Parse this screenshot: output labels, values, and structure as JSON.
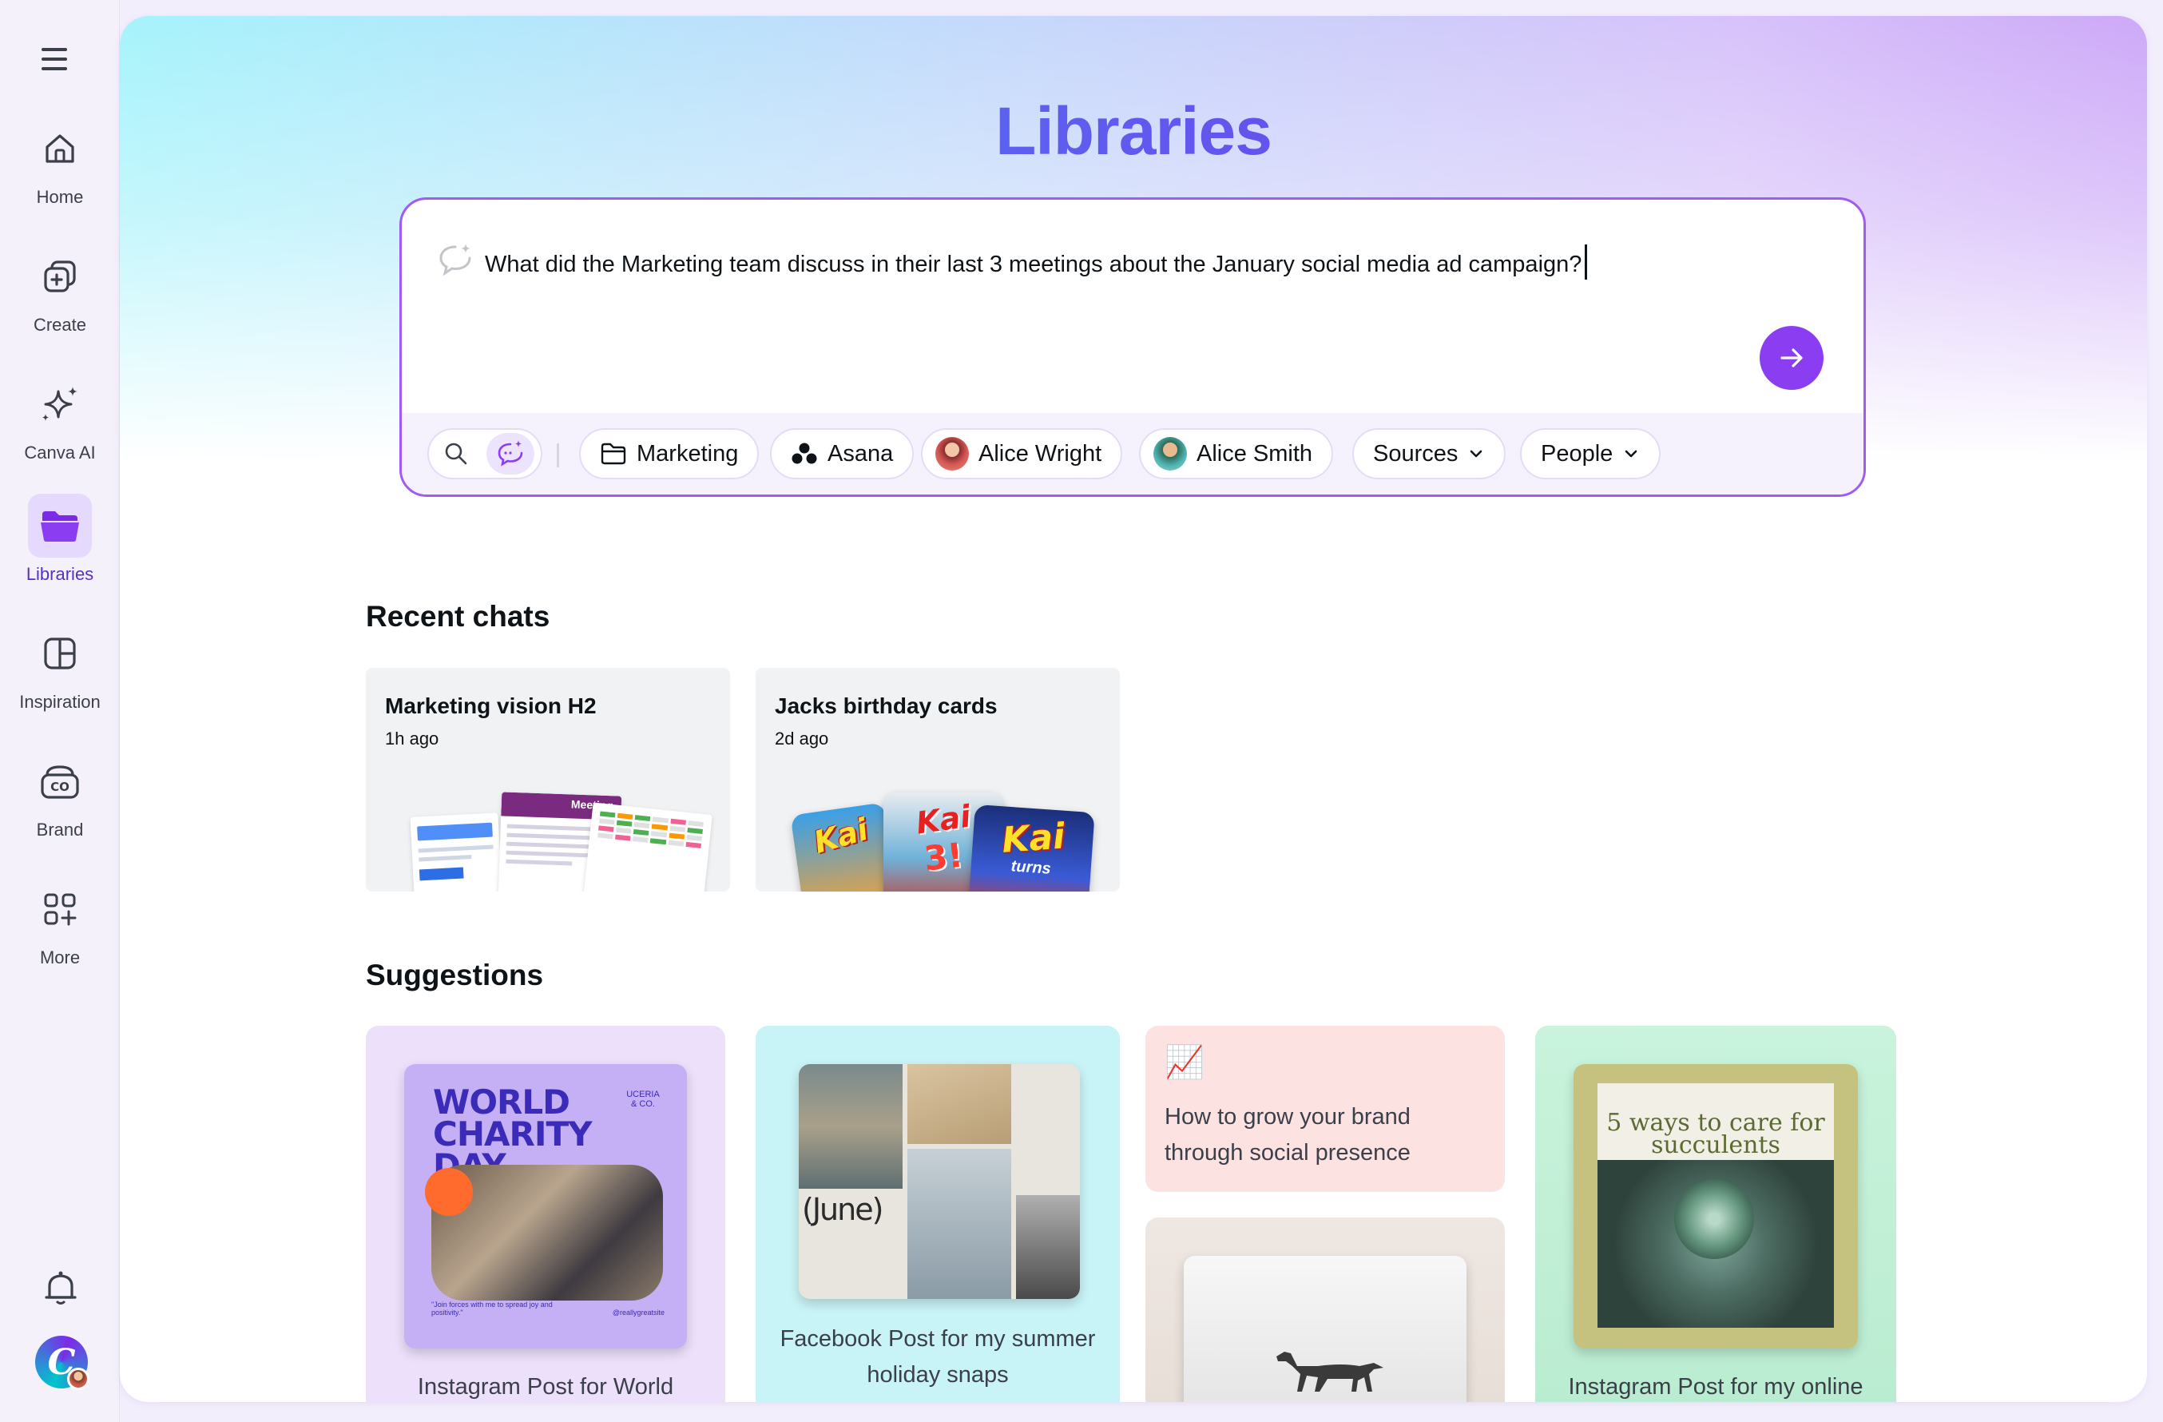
{
  "sidebar": {
    "items": [
      {
        "label": "Home",
        "icon": "home-icon"
      },
      {
        "label": "Create",
        "icon": "create-icon"
      },
      {
        "label": "Canva AI",
        "icon": "sparkle-icon"
      },
      {
        "label": "Libraries",
        "icon": "folder-icon",
        "active": true
      },
      {
        "label": "Inspiration",
        "icon": "inspiration-icon"
      },
      {
        "label": "Brand",
        "icon": "brand-icon"
      },
      {
        "label": "More",
        "icon": "apps-icon"
      }
    ],
    "notifications_icon": "bell-icon",
    "profile_initial": "C"
  },
  "page": {
    "title": "Libraries",
    "accent": "#8b3ef1"
  },
  "search": {
    "query": "What did the Marketing team discuss in their last 3 meetings about the January social media ad campaign?",
    "filters": [
      {
        "label": "Marketing",
        "icon": "folder-icon"
      },
      {
        "label": "Asana",
        "icon": "asana-icon"
      },
      {
        "label": "Alice Wright",
        "icon": "avatar"
      },
      {
        "label": "Alice Smith",
        "icon": "avatar"
      },
      {
        "label": "Sources",
        "icon": "chevron-down-icon"
      },
      {
        "label": "People",
        "icon": "chevron-down-icon"
      }
    ]
  },
  "recent_chats": {
    "heading": "Recent chats",
    "items": [
      {
        "title": "Marketing vision H2",
        "time": "1h ago",
        "thumb_label": "Meeting"
      },
      {
        "title": "Jacks birthday cards",
        "time": "2d ago",
        "thumb_text_a": "Kai",
        "thumb_text_b": "turns",
        "thumb_text_c": "3!"
      }
    ]
  },
  "suggestions": {
    "heading": "Suggestions",
    "items": [
      {
        "label": "Instagram Post for World",
        "img_title": "WORLD CHARITY DAY",
        "img_corner": "UCERIA & CO.",
        "img_quote": "\"Join forces with me to spread joy and positivity.\"",
        "img_handle": "@reallygreatsite"
      },
      {
        "label": "Facebook Post for my summer holiday snaps",
        "img_text": "(June)"
      },
      {
        "label": "How to grow your brand through social presence",
        "emoji": "📈"
      },
      {
        "label": ""
      },
      {
        "label": "Instagram Post for my online",
        "img_title": "5 ways to care for succulents"
      }
    ]
  }
}
